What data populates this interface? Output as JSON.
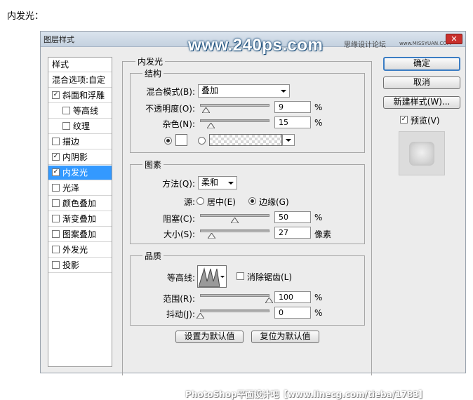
{
  "page_heading": "内发光：",
  "dialog": {
    "title": "图层样式",
    "watermark_main": "www.240ps.com",
    "watermark_forum": "思缘设计论坛",
    "watermark_url": "www.MISSYUAN.COM",
    "close_icon": "close-icon"
  },
  "left_list": {
    "header": "样式",
    "blend_options": "混合选项:自定",
    "items": [
      {
        "label": "斜面和浮雕",
        "checked": "✓"
      },
      {
        "label": "等高线",
        "checked": ""
      },
      {
        "label": "纹理",
        "checked": ""
      },
      {
        "label": "描边",
        "checked": ""
      },
      {
        "label": "内阴影",
        "checked": "✓"
      },
      {
        "label": "内发光",
        "checked": "✓"
      },
      {
        "label": "光泽",
        "checked": ""
      },
      {
        "label": "颜色叠加",
        "checked": ""
      },
      {
        "label": "渐变叠加",
        "checked": ""
      },
      {
        "label": "图案叠加",
        "checked": ""
      },
      {
        "label": "外发光",
        "checked": ""
      },
      {
        "label": "投影",
        "checked": ""
      }
    ]
  },
  "panel": {
    "title": "内发光",
    "structure": {
      "title": "结构",
      "blend_mode_label": "混合模式(B):",
      "blend_mode_value": "叠加",
      "opacity_label": "不透明度(O):",
      "opacity_value": "9",
      "opacity_unit": "%",
      "noise_label": "杂色(N):",
      "noise_value": "15",
      "noise_unit": "%"
    },
    "elements": {
      "title": "图素",
      "method_label": "方法(Q):",
      "method_value": "柔和",
      "source_label": "源:",
      "source_center": "居中(E)",
      "source_edge": "边缘(G)",
      "choke_label": "阻塞(C):",
      "choke_value": "50",
      "choke_unit": "%",
      "size_label": "大小(S):",
      "size_value": "27",
      "size_unit": "像素"
    },
    "quality": {
      "title": "品质",
      "contour_label": "等高线:",
      "antialias_label": "消除锯齿(L)",
      "range_label": "范围(R):",
      "range_value": "100",
      "range_unit": "%",
      "jitter_label": "抖动(J):",
      "jitter_value": "0",
      "jitter_unit": "%"
    },
    "make_default": "设置为默认值",
    "reset_default": "复位为默认值"
  },
  "right": {
    "ok": "确定",
    "cancel": "取消",
    "new_style": "新建样式(W)...",
    "preview_label": "预览(V)",
    "preview_checked": "✓"
  },
  "bottom_watermark": "PhotoShop平面设计吧【www.linecg.com/tieba/1783】"
}
